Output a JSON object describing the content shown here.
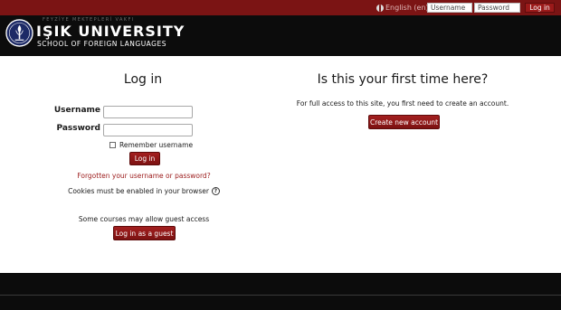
{
  "header": {
    "university_name": "IŞIK UNIVERSITY",
    "school_name": "SCHOOL OF FOREIGN LANGUAGES",
    "foundation_line": "FEYZİYE MEKTEPLERİ VAKFI",
    "language_label": "English (en)",
    "username_placeholder": "Username",
    "password_placeholder": "Password",
    "login_button": "Log in",
    "colors": {
      "topbar": "#7b1414",
      "header": "#0c0c0c",
      "accent": "#9b1a1a"
    }
  },
  "login": {
    "title": "Log in",
    "username_label": "Username",
    "password_label": "Password",
    "remember_label": "Remember username",
    "login_button": "Log in",
    "forgot_link": "Forgotten your username or password?",
    "cookies_text": "Cookies must be enabled in your browser",
    "guest_note": "Some courses may allow guest access",
    "guest_button": "Log in as a guest"
  },
  "signup": {
    "title": "Is this your first time here?",
    "description": "For full access to this site, you first need to create an account.",
    "create_button": "Create new account"
  },
  "icons": [
    "university-seal-icon",
    "globe-icon",
    "help-icon"
  ]
}
